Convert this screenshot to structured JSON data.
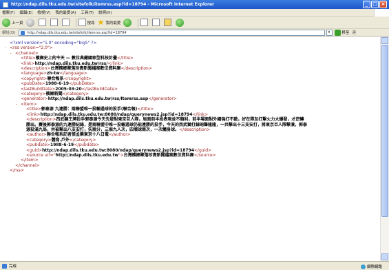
{
  "window": {
    "title": "http://ndap.dils.tku.edu.tw/sitefolk/itemrss.asp?id=18794 - Microsoft Internet Explorer",
    "buttons": [
      "_",
      "□",
      "×"
    ]
  },
  "menu": [
    "檔案(F)",
    "編輯(E)",
    "檢視(V)",
    "我的最愛(A)",
    "工具(T)",
    "說明(H)"
  ],
  "toolbar": {
    "back": "上一頁",
    "search": "搜尋",
    "favorites": "我的最愛"
  },
  "address": {
    "label": "網址(D)",
    "url": "http://ndap.dils.tku.edu.tw/sitefolk/itemrss.asp?id=18794",
    "go": "移至",
    "links": "連"
  },
  "xml": {
    "decl_open": "<?xml version=\"1.0\" encoding=\"big5\" ?>",
    "rss_open": "<rss version=\"2.0\">",
    "channel_open": "<channel>",
    "title": "檳榔史上的今天 — 數位典藏國家型科技計畫",
    "link": "http://ndap.dils.tku.edu.tw/rss/",
    "description": "台灣檳榔聚落珍貴新聞檔案數位資料庫",
    "language": "zh-tw",
    "copyright": "聯合報系",
    "pubDate": "1988-6-19",
    "lastBuildDate": "2005-03-20",
    "category": "檳榔新聞",
    "generator": "http://ndap.dils.tku.edu.tw/rss/Itemrss.asp",
    "item_open": "<item>",
    "item_title": "郭泰源 九連勝：兩聯盟唯一投輸過球的投手(聯合報)",
    "item_link": "http://ndap.dils.tku.edu.tw:8080/ndap/querynews2.jsp?id=18794",
    "item_description": "西武獅王牌投手郭泰源今天先發對東京巨人隊，局面前半段表現並不順利，前半場面對外國強打不敵，好在隊友打擊火力大爆發，才逆轉勝出。賽後郭泰源的九連勝紀錄，是兩聯盟中唯一投輸過球仍能連勝的投手，今天的西武獅打線砲聲隆隆，一共擊出十三支安打，將東京巨人隊擊潰，郭泰源投滿九局，共被擊出八支安打，失兩分，三振九人次，四壞球兩次，一次觸身球。",
    "item_author": "聯合報系記者張孟樂東京十八日電",
    "item_category": "體育.戶外",
    "item_pubdate": "1988-6-19",
    "item_guid": "http://ndap.dils.tku.edu.tw:8080/ndap/querynews2.jsp?id=18794",
    "item_source_url": "http://ndap.dils.tku.edu.tw",
    "item_source": "台灣檳榔聚落珍貴新聞檔案數位資料庫",
    "item_close": "</item>",
    "channel_close": "</channel>",
    "rss_close": "</rss>"
  },
  "status": {
    "text": "完成",
    "zone": "網際網路"
  }
}
